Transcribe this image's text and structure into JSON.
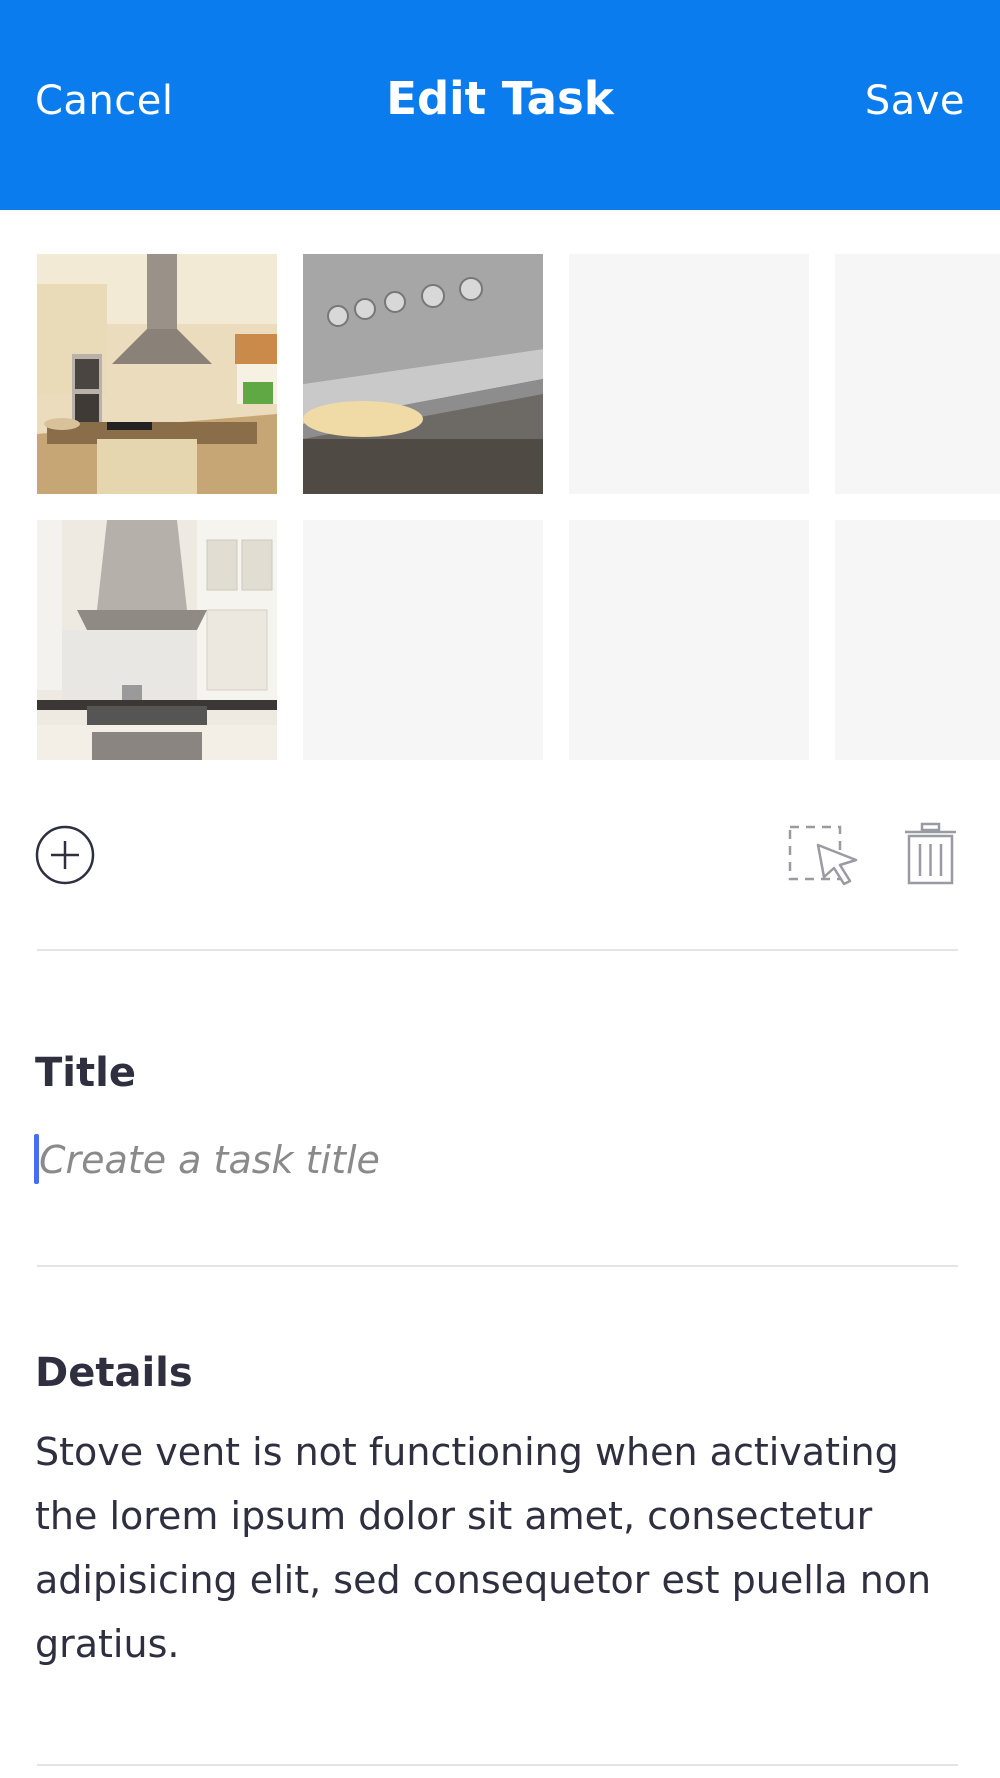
{
  "header": {
    "cancel_label": "Cancel",
    "title": "Edit Task",
    "save_label": "Save",
    "background_color": "#0a7ced"
  },
  "photos": [
    {
      "slot": 1,
      "content": "kitchen-island-photo"
    },
    {
      "slot": 2,
      "content": "stove-vent-knobs-photo"
    },
    {
      "slot": 3,
      "content": "empty"
    },
    {
      "slot": 4,
      "content": "empty"
    },
    {
      "slot": 5,
      "content": "range-hood-photo"
    },
    {
      "slot": 6,
      "content": "empty"
    },
    {
      "slot": 7,
      "content": "empty"
    },
    {
      "slot": 8,
      "content": "empty"
    }
  ],
  "actions": {
    "add_icon": "plus-circle-icon",
    "select_icon": "select-cursor-icon",
    "delete_icon": "trash-icon"
  },
  "title_field": {
    "label": "Title",
    "placeholder": "Create a task title",
    "value": ""
  },
  "details_field": {
    "label": "Details",
    "value": "Stove vent is not functioning when activating the lorem ipsum dolor sit amet, consectetur adipisicing elit, sed consequetor est puella non gratius."
  }
}
